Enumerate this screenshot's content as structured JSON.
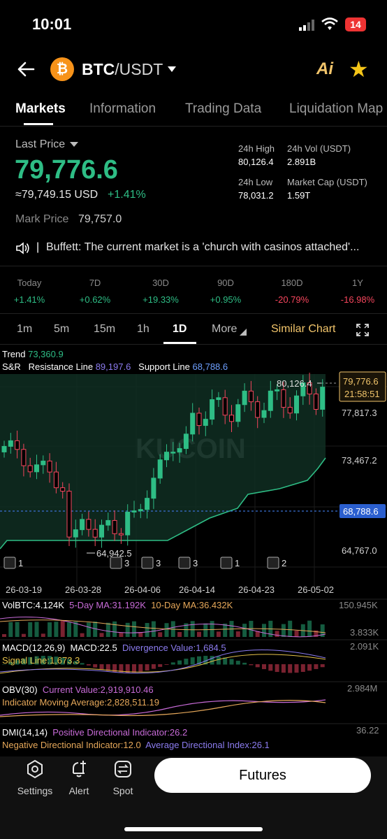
{
  "status_bar": {
    "time": "10:01",
    "battery": "14"
  },
  "header": {
    "pair_base": "BTC",
    "pair_quote": "/USDT",
    "ai_label": "Ai",
    "coin_symbol": "₿"
  },
  "tabs": [
    {
      "label": "Markets",
      "active": true
    },
    {
      "label": "Information",
      "active": false
    },
    {
      "label": "Trading Data",
      "active": false
    },
    {
      "label": "Liquidation Map",
      "active": false
    }
  ],
  "price": {
    "last_price_label": "Last Price",
    "last_price": "79,776.6",
    "usd_price": "≈79,749.15 USD",
    "change_pct": "+1.41%",
    "mark_label": "Mark Price",
    "mark_value": "79,757.0"
  },
  "stats": {
    "high_label": "24h High",
    "high_value": "80,126.4",
    "vol_label": "24h Vol (USDT)",
    "vol_value": "2.891B",
    "low_label": "24h Low",
    "low_value": "78,031.2",
    "cap_label": "Market Cap (USDT)",
    "cap_value": "1.59T"
  },
  "news": {
    "separator": "|",
    "text": "Buffett: The current market is a 'church with casinos attached'..."
  },
  "periods": [
    {
      "label": "Today",
      "value": "+1.41%",
      "up": true
    },
    {
      "label": "7D",
      "value": "+0.62%",
      "up": true
    },
    {
      "label": "30D",
      "value": "+19.33%",
      "up": true
    },
    {
      "label": "90D",
      "value": "+0.95%",
      "up": true
    },
    {
      "label": "180D",
      "value": "-20.79%",
      "up": false
    },
    {
      "label": "1Y",
      "value": "-16.98%",
      "up": false
    }
  ],
  "intervals": [
    {
      "label": "1m",
      "active": false
    },
    {
      "label": "5m",
      "active": false
    },
    {
      "label": "15m",
      "active": false
    },
    {
      "label": "1h",
      "active": false
    },
    {
      "label": "1D",
      "active": true
    },
    {
      "label": "More",
      "active": false
    }
  ],
  "similar_chart": "Similar Chart",
  "chart": {
    "trend_label": "Trend",
    "trend_value": "73,360.9",
    "sr_label": "S&R",
    "resistance_label": "Resistance Line",
    "resistance_value": "89,197.6",
    "support_label": "Support Line",
    "support_value": "68,788.6",
    "watermark": "KUCOIN",
    "high_marker": "80,126.4",
    "low_marker": "64,942.5",
    "current_price_tag": "79,776.6",
    "countdown_tag": "21:58:51",
    "support_tag": "68,788.6",
    "y_ticks": [
      "77,817.3",
      "73,467.2",
      "64,767.0"
    ],
    "x_ticks": [
      "26-03-19",
      "26-03-28",
      "26-04-06",
      "26-04-14",
      "26-04-23",
      "26-05-02"
    ],
    "news_badges": [
      "1",
      "3",
      "3",
      "3",
      "1",
      "2"
    ],
    "colors": {
      "up": "#2ebd85",
      "down": "#f6465d",
      "support": "#2ebd85",
      "tag": "#f2c56b",
      "support_tag": "#3b6fd4"
    }
  },
  "chart_data": {
    "type": "candlestick",
    "title": "",
    "xlabel": "",
    "ylabel": "",
    "ylim": [
      64767.0,
      80126.4
    ],
    "x_ticks": [
      "26-03-19",
      "26-03-28",
      "26-04-06",
      "26-04-14",
      "26-04-23",
      "26-05-02"
    ],
    "y_ticks": [
      77817.3,
      73467.2,
      64767.0
    ],
    "last": 79776.6,
    "high": 80126.4,
    "low": 64942.5,
    "support_line": 68788.6,
    "resistance_line": 89197.6,
    "trend": 73360.9
  },
  "indicators": {
    "vol": {
      "label": "VolBTC:4.124K",
      "ma5": "5-Day MA:31.192K",
      "ma10": "10-Day MA:36.432K",
      "max": "150.945K",
      "min": "3.833K"
    },
    "macd": {
      "label": "MACD(12,26,9)",
      "value": "MACD:22.5",
      "div": "Divergence Value:1,684.5",
      "signal": "Signal Line:1,673.3",
      "max": "2.091K"
    },
    "obv": {
      "label": "OBV(30)",
      "current": "Current Value:2,919,910.46",
      "ma": "Indicator Moving Average:2,828,511.19",
      "max": "2.984M"
    },
    "dmi": {
      "label": "DMI(14,14)",
      "pdi": "Positive Directional Indicator:26.2",
      "ndi": "Negative Directional Indicator:12.0",
      "adx": "Average Directional Index:26.1",
      "max": "36.22"
    }
  },
  "bottom_nav": {
    "settings": "Settings",
    "alert": "Alert",
    "spot": "Spot",
    "futures": "Futures"
  }
}
